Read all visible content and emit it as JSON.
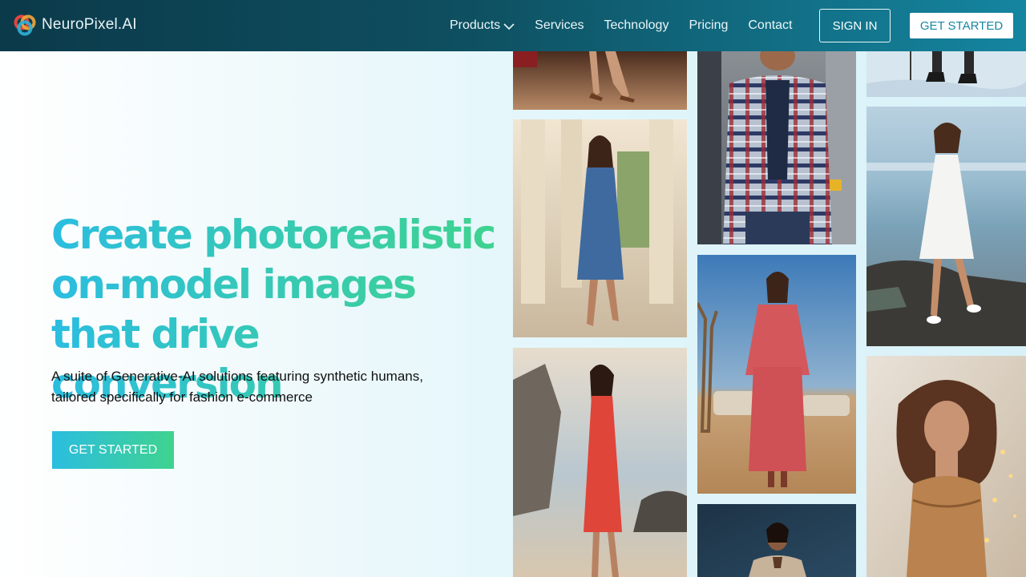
{
  "brand": {
    "name": "NeuroPixel.AI"
  },
  "nav": {
    "links": [
      {
        "label": "Products",
        "has_dropdown": true
      },
      {
        "label": "Services"
      },
      {
        "label": "Technology"
      },
      {
        "label": "Pricing"
      },
      {
        "label": "Contact"
      }
    ],
    "signin_label": "SIGN IN",
    "get_started_label": "GET STARTED"
  },
  "hero": {
    "title_lines": [
      "Create photorealistic",
      "on-model images",
      "that drive conversion"
    ],
    "subtitle": "A suite of Generative-AI solutions featuring synthetic humans, tailored specifically for fashion e-commerce",
    "cta_label": "GET STARTED"
  },
  "gallery": {
    "tiles": [
      {
        "id": "tile-heels-floor",
        "subject": "model in heels on polished floor"
      },
      {
        "id": "tile-blue-dress",
        "subject": "model in blue satin dress by columns"
      },
      {
        "id": "tile-red-dress-beach",
        "subject": "model in red dress on beach"
      },
      {
        "id": "tile-plaid-jacket",
        "subject": "man in plaid jacket on city street"
      },
      {
        "id": "tile-pink-outfit-desert",
        "subject": "model in pink outfit in desert"
      },
      {
        "id": "tile-saree-dark",
        "subject": "model in saree on dark background"
      },
      {
        "id": "tile-snow-boots",
        "subject": "boots in snow"
      },
      {
        "id": "tile-white-dress-shore",
        "subject": "model in white dress on rocky shore"
      },
      {
        "id": "tile-bronze-corset",
        "subject": "model in bronze corset with lights"
      }
    ]
  },
  "colors": {
    "nav_dark": "#0b3a4a",
    "nav_light": "#1585a0",
    "accent_cyan": "#2bbde0",
    "accent_green": "#3fd38f"
  }
}
